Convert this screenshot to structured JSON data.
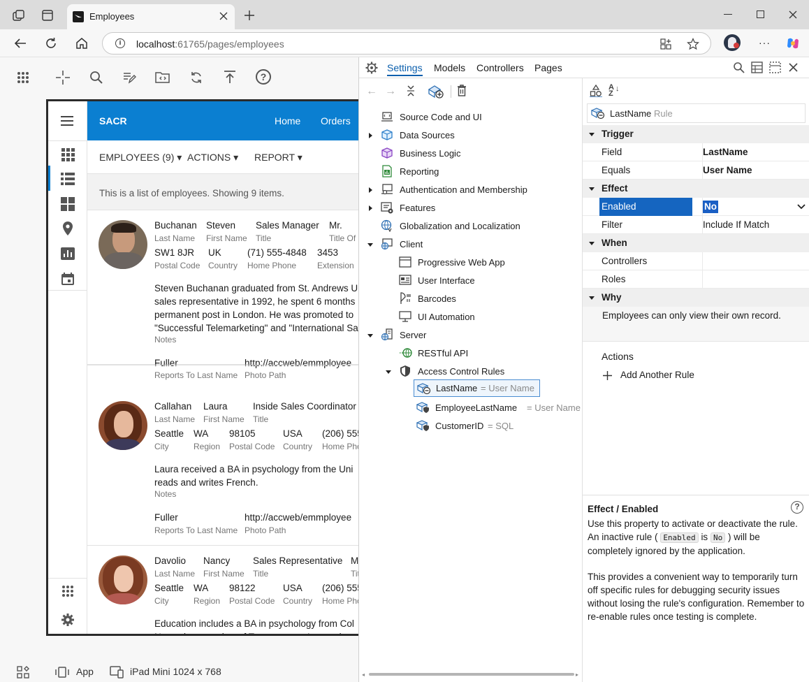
{
  "browser": {
    "tab_title": "Employees",
    "url_host": "localhost",
    "url_port": ":61765",
    "url_path": "/pages/employees"
  },
  "app": {
    "brand": "SACR",
    "nav": [
      "Home",
      "Orders"
    ],
    "subnav": [
      "EMPLOYEES (9)",
      "ACTIONS",
      "REPORT"
    ],
    "info": "This is a list of employees. Showing 9 items.",
    "employees": [
      {
        "last": "Buchanan",
        "first": "Steven",
        "title": "Sales Manager",
        "courtesy": "Mr.",
        "postal": "SW1 8JR",
        "country": "UK",
        "phone": "(71) 555-4848",
        "ext": "3453",
        "notes": "Steven Buchanan graduated from St. Andrews U\nsales representative in 1992, he spent 6 months\npermanent post in London. He was promoted to\n\"Successful Telemarketing\" and \"International Sa",
        "reports_to": "Fuller",
        "photo_path": "http://accweb/emmployee"
      },
      {
        "last": "Callahan",
        "first": "Laura",
        "title": "Inside Sales Coordinator",
        "city": "Seattle",
        "region": "WA",
        "postal": "98105",
        "country": "USA",
        "phone": "(206) 555",
        "notes": "Laura received a BA in psychology from the Uni\nreads and writes French.",
        "reports_to": "Fuller",
        "photo_path": "http://accweb/emmployee"
      },
      {
        "last": "Davolio",
        "first": "Nancy",
        "title": "Sales Representative",
        "courtesy": "M",
        "city": "Seattle",
        "region": "WA",
        "postal": "98122",
        "country": "USA",
        "phone": "(206) 555",
        "notes": "Education includes a BA in psychology from Col\nNancy is a member of Toastmasters Internation"
      }
    ],
    "labels": {
      "last": "Last Name",
      "first": "First Name",
      "title": "Title",
      "courtesy": "Title Of C",
      "postal": "Postal Code",
      "country": "Country",
      "phone": "Home Phone",
      "ext": "Extension",
      "city": "City",
      "region": "Region",
      "notes": "Notes",
      "reports_to": "Reports To Last Name",
      "photo_path": "Photo Path",
      "phone_short": "Home Pho",
      "title_short": "Tit"
    }
  },
  "bottom": {
    "app": "App",
    "device": "iPad Mini 1024 x 768"
  },
  "designer": {
    "tabs": [
      "Settings",
      "Models",
      "Controllers",
      "Pages"
    ],
    "tree": {
      "source": "Source Code and UI",
      "data_sources": "Data Sources",
      "business_logic": "Business Logic",
      "reporting": "Reporting",
      "auth": "Authentication and Membership",
      "features": "Features",
      "globalization": "Globalization and Localization",
      "client": "Client",
      "pwa": "Progressive Web App",
      "ui": "User Interface",
      "barcodes": "Barcodes",
      "ui_automation": "UI Automation",
      "server": "Server",
      "restful": "RESTful API",
      "acr": "Access Control Rules",
      "rule1": "LastName",
      "rule1_val": "= User Name",
      "rule2": "EmployeeLastName",
      "rule2_val": "= User Name",
      "rule3": "CustomerID",
      "rule3_val": "= SQL"
    },
    "props": {
      "header_name": "LastName",
      "header_type": "Rule",
      "trigger": "Trigger",
      "field_k": "Field",
      "field_v": "LastName",
      "equals_k": "Equals",
      "equals_v": "User Name",
      "effect": "Effect",
      "enabled_k": "Enabled",
      "enabled_v": "No",
      "filter_k": "Filter",
      "filter_v": "Include If Match",
      "when": "When",
      "controllers_k": "Controllers",
      "roles_k": "Roles",
      "why": "Why",
      "why_v": "Employees can only view their own record.",
      "actions": "Actions",
      "add_rule": "Add Another Rule"
    },
    "help": {
      "title": "Effect / Enabled",
      "p1a": "Use this property to activate or deactivate the rule. An inactive rule (",
      "code1": "Enabled",
      "p1b": "is",
      "code2": "No",
      "p1c": ") will be completely ignored by the application.",
      "p2": "This provides a convenient way to temporarily turn off specific rules for debugging security issues without losing the rule's configuration. Remember to re-enable rules once testing is complete."
    }
  },
  "colors": {
    "accent": "#0b7fd1",
    "selected": "#1565c0",
    "brand_bar": "#0b7fd1"
  }
}
